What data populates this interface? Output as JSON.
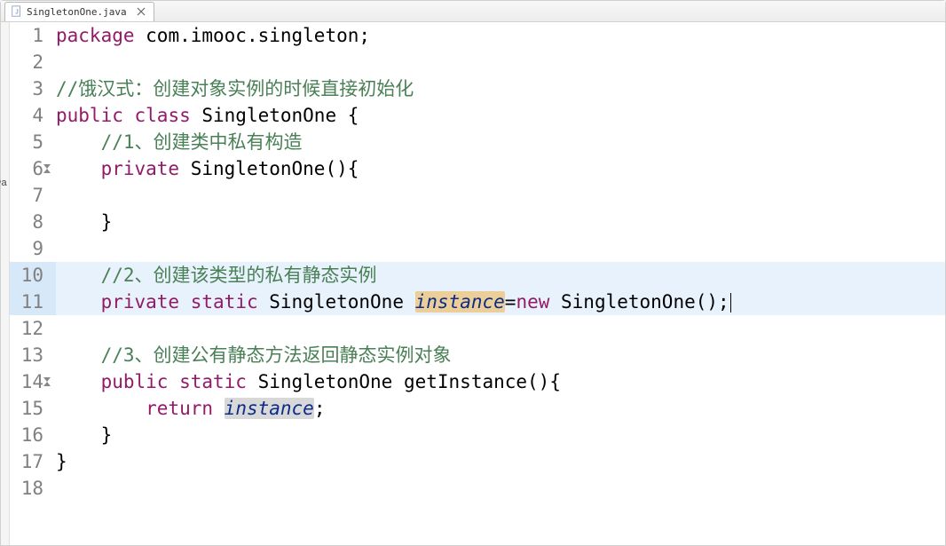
{
  "tab": {
    "filename": "SingletonOne.java",
    "file_icon": "java-file-icon",
    "close": "×"
  },
  "truncLabel": "᠈a",
  "code": {
    "lines": [
      {
        "num": "1",
        "modified": false,
        "segments": [
          {
            "cls": "kw-package",
            "t": "package"
          },
          {
            "cls": "text-black",
            "t": " com.imooc.singleton;"
          }
        ]
      },
      {
        "num": "2",
        "modified": false,
        "segments": []
      },
      {
        "num": "3",
        "modified": false,
        "segments": [
          {
            "cls": "comment",
            "t": "//饿汉式：创建对象实例的时候直接初始化"
          }
        ]
      },
      {
        "num": "4",
        "modified": false,
        "segments": [
          {
            "cls": "kw-public",
            "t": "public"
          },
          {
            "cls": "text-black",
            "t": " "
          },
          {
            "cls": "kw-class",
            "t": "class"
          },
          {
            "cls": "text-black",
            "t": " SingletonOne {"
          }
        ]
      },
      {
        "num": "5",
        "modified": false,
        "indent": "    ",
        "segments": [
          {
            "cls": "comment",
            "t": "//1、创建类中私有构造"
          }
        ]
      },
      {
        "num": "6",
        "modified": true,
        "indent": "    ",
        "segments": [
          {
            "cls": "kw-private",
            "t": "private"
          },
          {
            "cls": "text-black",
            "t": " SingletonOne(){"
          }
        ]
      },
      {
        "num": "7",
        "modified": false,
        "indent": "        ",
        "segments": []
      },
      {
        "num": "8",
        "modified": false,
        "indent": "    ",
        "segments": [
          {
            "cls": "text-black",
            "t": "}"
          }
        ]
      },
      {
        "num": "9",
        "modified": false,
        "segments": []
      },
      {
        "num": "10",
        "modified": false,
        "highlighted": true,
        "indent": "    ",
        "segments": [
          {
            "cls": "comment",
            "t": "//2、创建该类型的私有静态实例"
          }
        ]
      },
      {
        "num": "11",
        "modified": false,
        "highlighted": true,
        "current": true,
        "indent": "    ",
        "segments": [
          {
            "cls": "kw-private",
            "t": "private"
          },
          {
            "cls": "text-black",
            "t": " "
          },
          {
            "cls": "kw-static",
            "t": "static"
          },
          {
            "cls": "text-black",
            "t": " SingletonOne "
          },
          {
            "cls": "field-italic highlight-write",
            "t": "instance"
          },
          {
            "cls": "text-black",
            "t": "="
          },
          {
            "cls": "kw-new",
            "t": "new"
          },
          {
            "cls": "text-black",
            "t": " SingletonOne();"
          }
        ]
      },
      {
        "num": "12",
        "modified": false,
        "segments": []
      },
      {
        "num": "13",
        "modified": false,
        "indent": "    ",
        "segments": [
          {
            "cls": "comment",
            "t": "//3、创建公有静态方法返回静态实例对象"
          }
        ]
      },
      {
        "num": "14",
        "modified": true,
        "indent": "    ",
        "segments": [
          {
            "cls": "kw-public",
            "t": "public"
          },
          {
            "cls": "text-black",
            "t": " "
          },
          {
            "cls": "kw-static",
            "t": "static"
          },
          {
            "cls": "text-black",
            "t": " SingletonOne getInstance(){"
          }
        ]
      },
      {
        "num": "15",
        "modified": false,
        "indent": "        ",
        "segments": [
          {
            "cls": "kw-return",
            "t": "return"
          },
          {
            "cls": "text-black",
            "t": " "
          },
          {
            "cls": "field-italic highlight-read",
            "t": "instance"
          },
          {
            "cls": "text-black",
            "t": ";"
          }
        ]
      },
      {
        "num": "16",
        "modified": false,
        "indent": "    ",
        "segments": [
          {
            "cls": "text-black",
            "t": "}"
          }
        ]
      },
      {
        "num": "17",
        "modified": false,
        "segments": [
          {
            "cls": "text-black",
            "t": "}"
          }
        ]
      },
      {
        "num": "18",
        "modified": false,
        "segments": []
      }
    ]
  }
}
